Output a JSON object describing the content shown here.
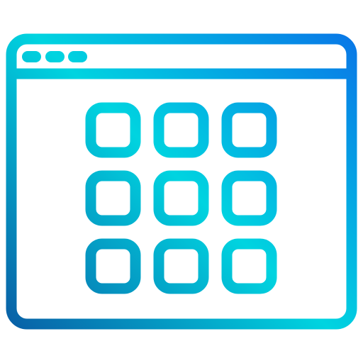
{
  "icon": {
    "name": "browser-app-grid-icon",
    "window_dots": 3,
    "grid": {
      "rows": 3,
      "cols": 3
    }
  },
  "colors": {
    "gradient_top_right": "#0a6ae8",
    "gradient_mid": "#00d4e0",
    "gradient_bottom_left": "#0a4f9e",
    "background": "#ffffff"
  }
}
